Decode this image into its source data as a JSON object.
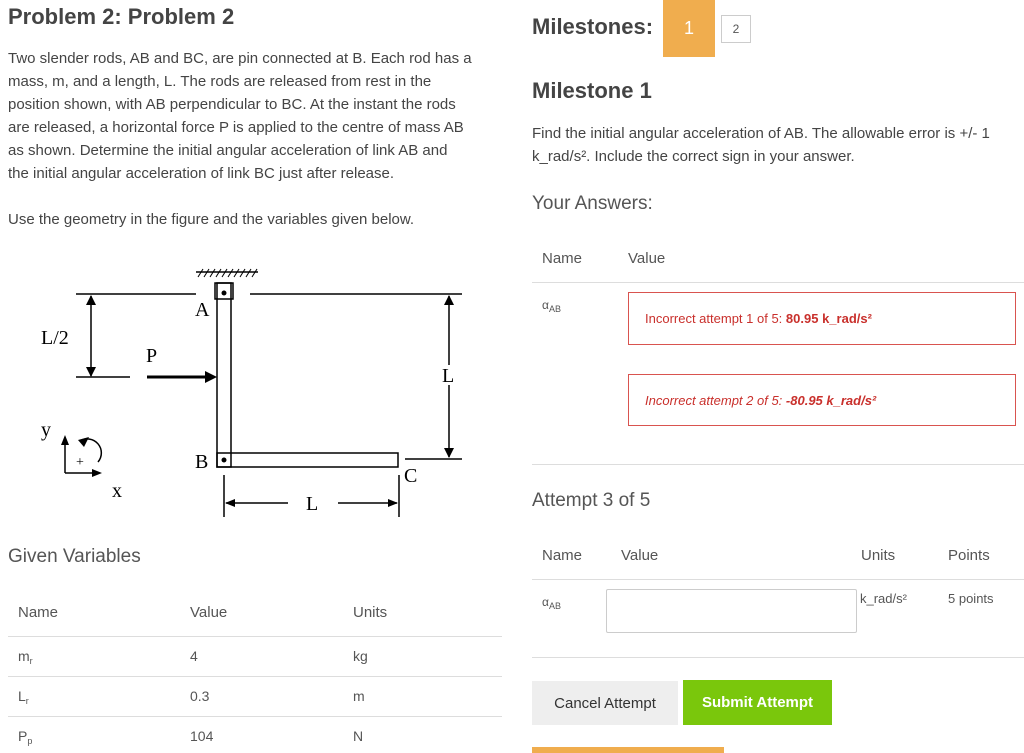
{
  "problem": {
    "title": "Problem 2: Problem 2",
    "description": [
      "Two slender rods, AB and BC, are pin connected at B.  Each rod has a",
      "mass, m, and a length, L.  The rods are released from rest in the",
      "position shown, with AB perpendicular to BC.  At the instant the rods",
      "are released, a horizontal force P is applied to the centre of mass AB",
      "as shown.  Determine the initial angular acceleration of link AB and",
      "the initial angular acceleration of link BC just after release."
    ],
    "instruction": "Use the geometry in the figure and the variables given below."
  },
  "figure": {
    "label_half_length": "L/2",
    "label_force": "P",
    "label_A": "A",
    "label_B": "B",
    "label_C": "C",
    "label_L_vertical": "L",
    "label_L_horizontal": "L",
    "label_y": "y",
    "label_x": "x",
    "label_plus": "+"
  },
  "given": {
    "heading": "Given Variables",
    "headers": {
      "name": "Name",
      "value": "Value",
      "units": "Units"
    },
    "rows": [
      {
        "name": "m",
        "sub": "r",
        "value": "4",
        "units": "kg"
      },
      {
        "name": "L",
        "sub": "r",
        "value": "0.3",
        "units": "m"
      },
      {
        "name": "P",
        "sub": "p",
        "value": "104",
        "units": "N"
      }
    ]
  },
  "milestones": {
    "label": "Milestones:",
    "items": [
      "1",
      "2"
    ],
    "active": "1",
    "active_color": "#f0ad4e"
  },
  "milestone": {
    "title": "Milestone 1",
    "text_line1": "Find the initial angular acceleration of AB. The allowable error is +/- 1",
    "text_line2": "k_rad/s². Include the correct sign in your answer."
  },
  "answers": {
    "heading": "Your Answers:",
    "headers": {
      "name": "Name",
      "value": "Value"
    },
    "name": "α",
    "name_sub": "AB",
    "attempts": [
      {
        "prefix": "Incorrect attempt 1 of 5: ",
        "value": "80.95 k_rad/s²"
      },
      {
        "prefix": "Incorrect attempt 2 of 5: ",
        "value": "-80.95 k_rad/s²"
      }
    ],
    "error_color": "#d9534f"
  },
  "attempt": {
    "heading": "Attempt 3 of 5",
    "headers": {
      "name": "Name",
      "value": "Value",
      "units": "Units",
      "points": "Points"
    },
    "name": "α",
    "name_sub": "AB",
    "input_value": "",
    "units": "k_rad/s²",
    "points": "5 points"
  },
  "buttons": {
    "cancel": "Cancel Attempt",
    "submit": "Submit Attempt",
    "submit_color": "#7ac70c"
  }
}
